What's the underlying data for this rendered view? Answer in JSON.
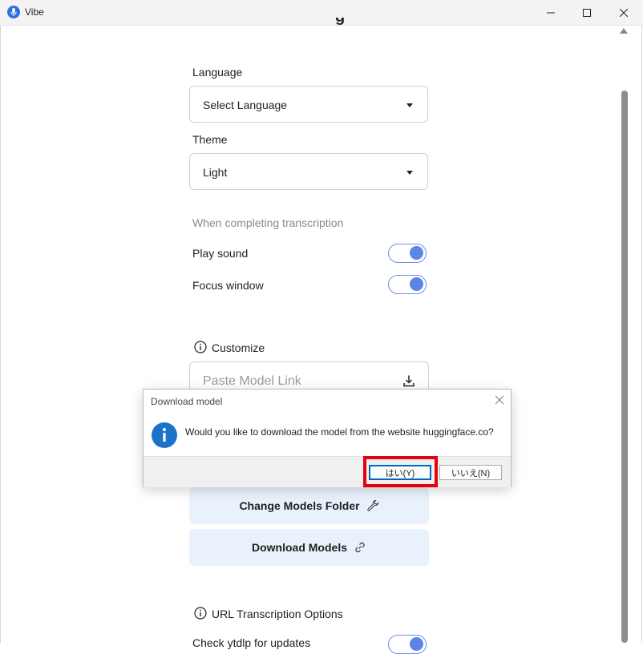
{
  "window": {
    "title": "Vibe"
  },
  "settings": {
    "language": {
      "label": "Language",
      "value": "Select Language"
    },
    "theme": {
      "label": "Theme",
      "value": "Light"
    },
    "completion_heading": "When completing transcription",
    "play_sound": {
      "label": "Play sound",
      "on": true
    },
    "focus_window": {
      "label": "Focus window",
      "on": true
    },
    "customize": {
      "label": "Customize",
      "paste_placeholder": "Paste Model Link"
    },
    "change_models_folder": "Change Models Folder",
    "download_models": "Download Models",
    "url_options": {
      "label": "URL Transcription Options"
    },
    "check_ytdlp": {
      "label": "Check ytdlp for updates",
      "on": true
    }
  },
  "dialog": {
    "title": "Download model",
    "message": "Would you like to download the model from the website huggingface.co?",
    "yes_label": "はい(Y)",
    "no_label": "いいえ(N)"
  },
  "colors": {
    "accent": "#5b86e5",
    "highlight": "#e8000b",
    "button_bg": "#e9f2fc"
  }
}
